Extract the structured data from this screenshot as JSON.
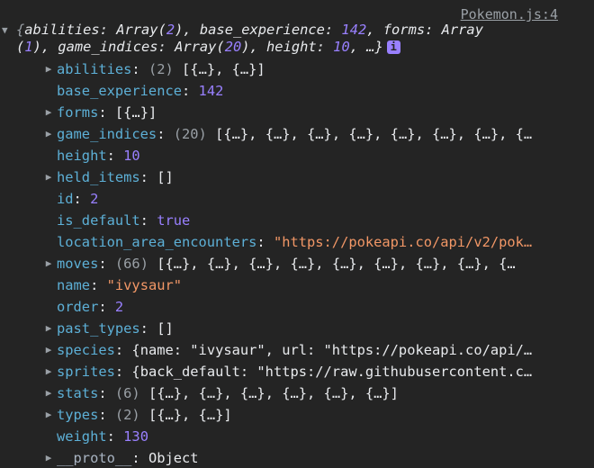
{
  "source_link": "Pokemon.js:4",
  "summary": {
    "toggle_icon": "triangle-down-icon",
    "open_brace": "{",
    "parts": [
      {
        "k": "abilities",
        "v": "Array(2)"
      },
      {
        "k": "base_experience",
        "v": "142"
      },
      {
        "k": "forms",
        "v": "Array"
      },
      {
        "k": "",
        "v": "(1)"
      },
      {
        "k": "game_indices",
        "v": "Array(20)"
      },
      {
        "k": "height",
        "v": "10"
      }
    ],
    "line1": "abilities: Array(2), base_experience: 142, forms: Array",
    "line2": "(1), game_indices: Array(20), height: 10, …}",
    "info_badge": "i"
  },
  "rows": [
    {
      "expandable": true,
      "name": "abilities",
      "count": "(2)",
      "value": "[{…}, {…}]",
      "type": "plain"
    },
    {
      "expandable": false,
      "name": "base_experience",
      "count": "",
      "value": "142",
      "type": "num"
    },
    {
      "expandable": true,
      "name": "forms",
      "count": "",
      "value": "[{…}]",
      "type": "plain"
    },
    {
      "expandable": true,
      "name": "game_indices",
      "count": "(20)",
      "value": "[{…}, {…}, {…}, {…}, {…}, {…}, {…}, {…",
      "type": "plain"
    },
    {
      "expandable": false,
      "name": "height",
      "count": "",
      "value": "10",
      "type": "num"
    },
    {
      "expandable": true,
      "name": "held_items",
      "count": "",
      "value": "[]",
      "type": "plain"
    },
    {
      "expandable": false,
      "name": "id",
      "count": "",
      "value": "2",
      "type": "num"
    },
    {
      "expandable": false,
      "name": "is_default",
      "count": "",
      "value": "true",
      "type": "bool"
    },
    {
      "expandable": false,
      "name": "location_area_encounters",
      "count": "",
      "value": "\"https://pokeapi.co/api/v2/pok…",
      "type": "str"
    },
    {
      "expandable": true,
      "name": "moves",
      "count": "(66)",
      "value": "[{…}, {…}, {…}, {…}, {…}, {…}, {…}, {…}, {…",
      "type": "plain"
    },
    {
      "expandable": false,
      "name": "name",
      "count": "",
      "value": "\"ivysaur\"",
      "type": "str"
    },
    {
      "expandable": false,
      "name": "order",
      "count": "",
      "value": "2",
      "type": "num"
    },
    {
      "expandable": true,
      "name": "past_types",
      "count": "",
      "value": "[]",
      "type": "plain"
    },
    {
      "expandable": true,
      "name": "species",
      "count": "",
      "value": "{name: \"ivysaur\", url: \"https://pokeapi.co/api/…",
      "type": "plain"
    },
    {
      "expandable": true,
      "name": "sprites",
      "count": "",
      "value": "{back_default: \"https://raw.githubusercontent.c…",
      "type": "plain"
    },
    {
      "expandable": true,
      "name": "stats",
      "count": "(6)",
      "value": "[{…}, {…}, {…}, {…}, {…}, {…}]",
      "type": "plain"
    },
    {
      "expandable": true,
      "name": "types",
      "count": "(2)",
      "value": "[{…}, {…}]",
      "type": "plain"
    },
    {
      "expandable": false,
      "name": "weight",
      "count": "",
      "value": "130",
      "type": "num"
    },
    {
      "expandable": true,
      "name": "__proto__",
      "count": "",
      "value": "Object",
      "type": "plain",
      "proto": true
    }
  ],
  "colors": {
    "background": "#242424",
    "key": "#5db0d7",
    "number": "#9980ff",
    "string": "#f29766",
    "muted": "#9aa0a6"
  },
  "icons": {
    "collapsed": "triangle-right-icon",
    "expanded": "triangle-down-icon"
  }
}
